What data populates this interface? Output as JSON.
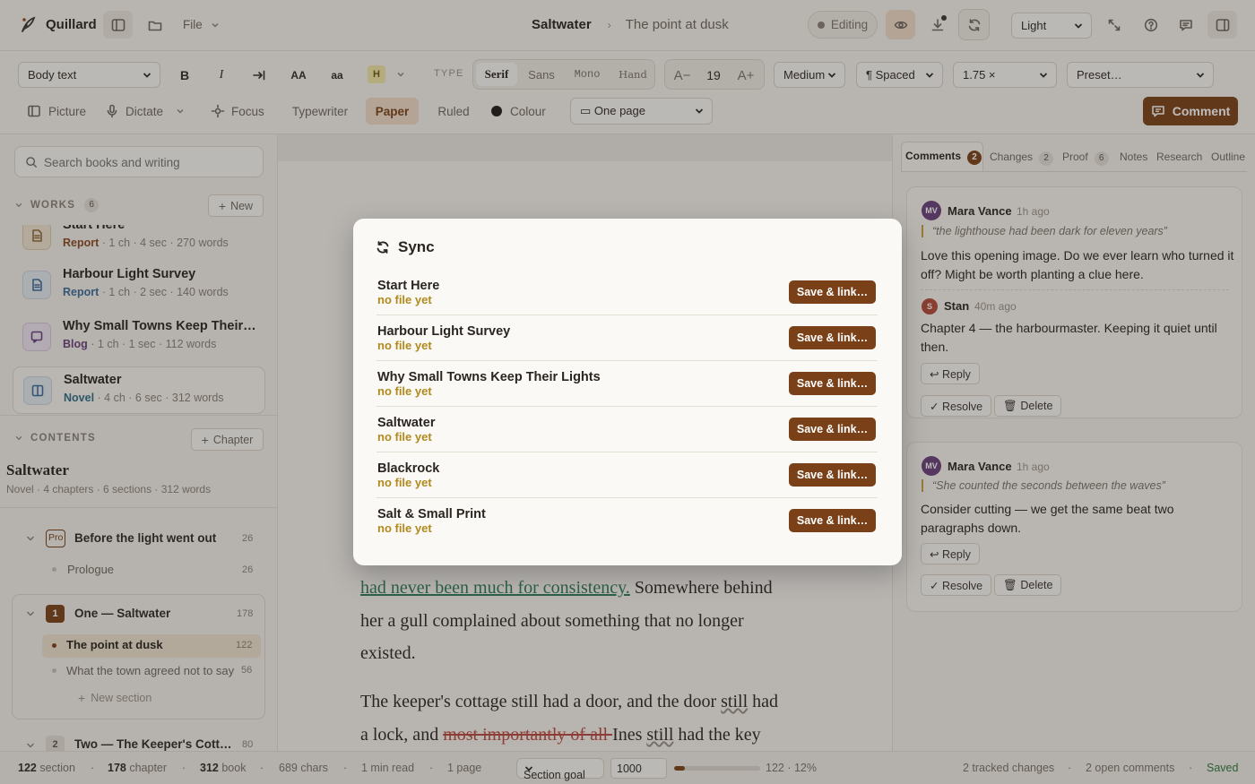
{
  "app": {
    "name": "Quillard",
    "file_menu": "File"
  },
  "header": {
    "book": "Saltwater",
    "section": "The point at dusk",
    "mode": "Editing",
    "theme": "Light"
  },
  "toolbar": {
    "paragraph_style": "Body text",
    "bold": "B",
    "italic": "I",
    "upper": "AA",
    "lower": "aa",
    "highlight": "H",
    "type_label": "TYPE",
    "type_options": [
      "Serif",
      "Sans",
      "Mono",
      "Hand"
    ],
    "font_smaller": "A−",
    "font_size": "19",
    "font_larger": "A+",
    "weight": "Medium",
    "spacing": "¶ Spaced",
    "line_height": "1.75 ×",
    "preset": "Preset…",
    "picture": "Picture",
    "dictate": "Dictate",
    "focus": "Focus",
    "typewriter": "Typewriter",
    "paper": "Paper",
    "ruled": "Ruled",
    "colour": "Colour",
    "page_mode": "▭ One page",
    "comment": "Comment"
  },
  "sidebar": {
    "search_placeholder": "Search books and writing",
    "works_label": "WORKS",
    "works_count": "6",
    "new_label": "New",
    "works": [
      {
        "title": "Start Here",
        "kind": "Report",
        "meta": " · 1 ch · 4 sec · 270 words"
      },
      {
        "title": "Harbour Light Survey",
        "kind": "Report",
        "meta": " · 1 ch · 2 sec · 140 words"
      },
      {
        "title": "Why Small Towns Keep Their…",
        "kind": "Blog",
        "meta": " · 1 ch · 1 sec · 112 words"
      },
      {
        "title": "Saltwater",
        "kind": "Novel",
        "meta": " · 4 ch · 6 sec · 312 words"
      }
    ],
    "contents_label": "CONTENTS",
    "chapter_label": "Chapter",
    "book_title": "Saltwater",
    "book_meta": "Novel · 4 chapters · 6 sections · 312 words",
    "toc": {
      "pro_badge": "Pro",
      "ch0": "Before the light went out",
      "ch0_count": "26",
      "s_prologue": "Prologue",
      "s_prologue_count": "26",
      "ch1_badge": "1",
      "ch1": "One — Saltwater",
      "ch1_count": "178",
      "s1": "The point at dusk",
      "s1_count": "122",
      "s2": "What the town agreed not to say",
      "s2_count": "56",
      "new_section": "New section",
      "ch2_badge": "2",
      "ch2": "Two — The Keeper's Cott…",
      "ch2_count": "80"
    }
  },
  "editor": {
    "line1": "had never been much for consistency.",
    "line1b": " Somewhere behind",
    "line2": "her a gull complained about something that no longer",
    "line3": "existed.",
    "line4a": "The keeper's cottage still had a door, and the door ",
    "line4b": "still",
    "line4c": " had",
    "line5a": "a lock, and ",
    "line5del": "most importantly of all ",
    "line5b": "Ines ",
    "line5c": "still",
    "line5d": " had the key"
  },
  "panel": {
    "tabs": [
      {
        "label": "Comments",
        "count": "2"
      },
      {
        "label": "Changes",
        "count": "2"
      },
      {
        "label": "Proof",
        "count": "6"
      },
      {
        "label": "Notes",
        "count": ""
      },
      {
        "label": "Research",
        "count": ""
      },
      {
        "label": "Outline",
        "count": ""
      }
    ],
    "comments": [
      {
        "initials": "MV",
        "author": "Mara Vance",
        "time": "1h ago",
        "quote": "“the lighthouse had been dark for eleven years”",
        "text1": "Love this opening image. Do we ever learn who turned it",
        "text2": "off? Might be worth planting a clue here.",
        "reply_initials": "S",
        "reply_author": "Stan",
        "reply_time": "40m ago",
        "reply1": "Chapter 4 — the harbourmaster. Keeping it quiet until",
        "reply2": "then."
      },
      {
        "initials": "MV",
        "author": "Mara Vance",
        "time": "1h ago",
        "quote": "“She counted the seconds between the waves”",
        "text1": "Consider cutting — we get the same beat two",
        "text2": "paragraphs down."
      }
    ],
    "reply": "↩ Reply",
    "resolve": "✓ Resolve",
    "delete": "🗑 Delete"
  },
  "status": {
    "section_n": "122",
    "section_l": "section",
    "chapter_n": "178",
    "chapter_l": "chapter",
    "book_n": "312",
    "book_l": "book",
    "chars": "689 chars",
    "read": "1 min read",
    "pages": "1 page",
    "goal_select": "Section goal",
    "goal_value": "1000",
    "goal_progress": 0.122,
    "goal_text": "122 · 12%",
    "tracked": "2 tracked changes",
    "open_comments": "2 open comments",
    "saved": "Saved"
  },
  "modal": {
    "title": "Sync",
    "rows": [
      {
        "title": "Start Here",
        "status": "no file yet",
        "action": "Save & link…"
      },
      {
        "title": "Harbour Light Survey",
        "status": "no file yet",
        "action": "Save & link…"
      },
      {
        "title": "Why Small Towns Keep Their Lights",
        "status": "no file yet",
        "action": "Save & link…"
      },
      {
        "title": "Saltwater",
        "status": "no file yet",
        "action": "Save & link…"
      },
      {
        "title": "Blackrock",
        "status": "no file yet",
        "action": "Save & link…"
      },
      {
        "title": "Salt & Small Print",
        "status": "no file yet",
        "action": "Save & link…"
      }
    ]
  },
  "colors": {
    "accent": "#7a4118",
    "highlight": "#efe2cf",
    "sync_status": "#b08a1e",
    "saved": "#2e7a3e"
  }
}
